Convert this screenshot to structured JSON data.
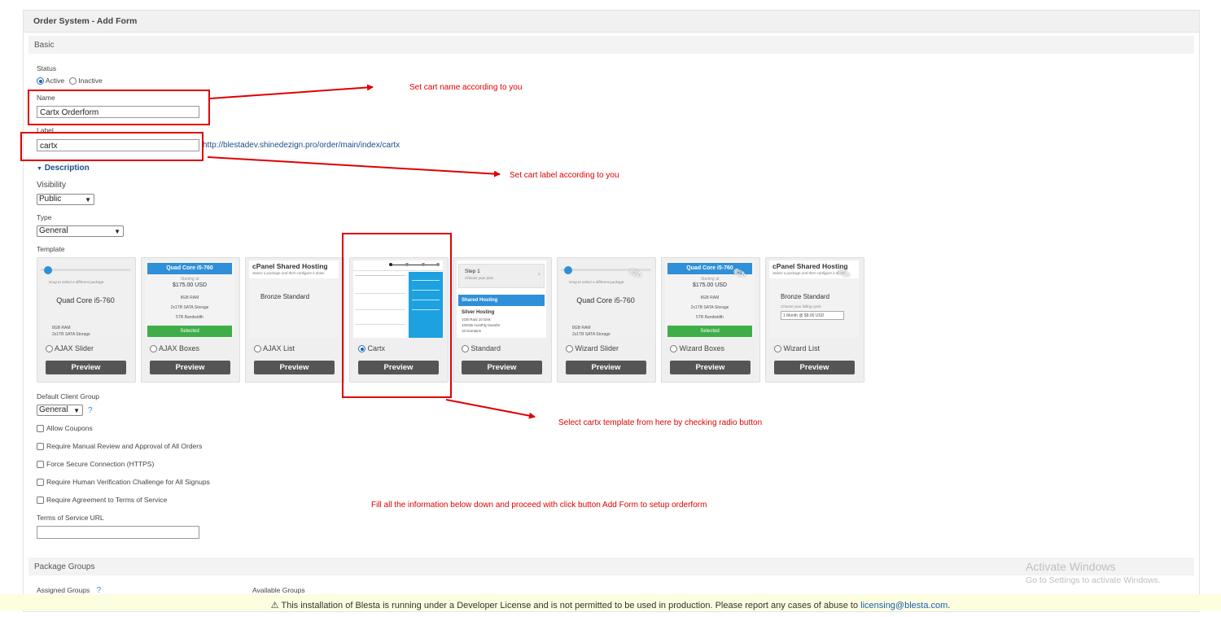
{
  "panel": {
    "title": "Order System - Add Form"
  },
  "basic": {
    "heading": "Basic"
  },
  "status": {
    "label": "Status",
    "active": "Active",
    "inactive": "Inactive"
  },
  "name": {
    "label": "Name",
    "value": "Cartx Orderform"
  },
  "label_field": {
    "label": "Label",
    "value": "cartx",
    "url": "http://blestadev.shinedezign.pro/order/main/index/cartx"
  },
  "description": {
    "toggle": "Description"
  },
  "visibility": {
    "label": "Visibility",
    "value": "Public"
  },
  "type": {
    "label": "Type",
    "value": "General"
  },
  "template": {
    "label": "Template",
    "preview_label": "Preview",
    "items": [
      {
        "name": "AJAX Slider",
        "selected": false
      },
      {
        "name": "AJAX Boxes",
        "selected": false
      },
      {
        "name": "AJAX List",
        "selected": false
      },
      {
        "name": "Cartx",
        "selected": true
      },
      {
        "name": "Standard",
        "selected": false
      },
      {
        "name": "Wizard Slider",
        "selected": false
      },
      {
        "name": "Wizard Boxes",
        "selected": false
      },
      {
        "name": "Wizard List",
        "selected": false
      }
    ],
    "thumbs": {
      "slider_hint": "Drag to select a different package.",
      "package_name": "Quad Core i5-760",
      "ram": "8GB RAM",
      "storage": "2x1TB SATA Storage",
      "bandwidth": "5TB Bandwidth",
      "starting_at": "Starting at",
      "price": "$175.00 USD",
      "selected": "Selected",
      "list_title": "cPanel Shared Hosting",
      "list_sub": "Select a package and then configure it down",
      "bronze": "Bronze Standard",
      "cycle_hint": "Choose your billing cycle",
      "cycle_value": "1 Month @ $8.00 USD",
      "step": "Step 1",
      "step_sub": "Choose your plan",
      "shared": "Shared Hosting",
      "silver": "Silver Hosting",
      "silver_1": "1GB Raid 10 Disk",
      "silver_2": "100GB monthly transfer",
      "silver_3": "10 Domains"
    }
  },
  "client_group": {
    "label": "Default Client Group",
    "value": "General",
    "help": "?"
  },
  "options": {
    "allow_coupons": "Allow Coupons",
    "manual_review": "Require Manual Review and Approval of All Orders",
    "force_secure": "Force Secure Connection (HTTPS)",
    "human_verification": "Require Human Verification Challenge for All Signups",
    "require_tos": "Require Agreement to Terms of Service"
  },
  "tos": {
    "label": "Terms of Service URL",
    "value": ""
  },
  "package_groups": {
    "heading": "Package Groups",
    "assigned": "Assigned Groups",
    "help": "?",
    "available": "Available Groups"
  },
  "annotations": {
    "name_note": "Set cart name according to you",
    "label_note": "Set cart label according to you",
    "template_note": "Select cartx template from here by checking radio button",
    "fill_note": "Fill all the information below down and proceed with click button Add Form to setup orderform"
  },
  "watermark": {
    "title": "Activate Windows",
    "sub": "Go to Settings to activate Windows."
  },
  "footer": {
    "icon": "warning-icon",
    "message": "This installation of Blesta is running under a Developer License and is not permitted to be used in production. Please report any cases of abuse to",
    "link": "licensing@blesta.com",
    "end": "."
  },
  "colors": {
    "annotation": "#e00000",
    "link": "#1a5fb4",
    "preview_button": "#555555",
    "accent_blue": "#2f8fd8",
    "accent_green": "#3fae49"
  }
}
